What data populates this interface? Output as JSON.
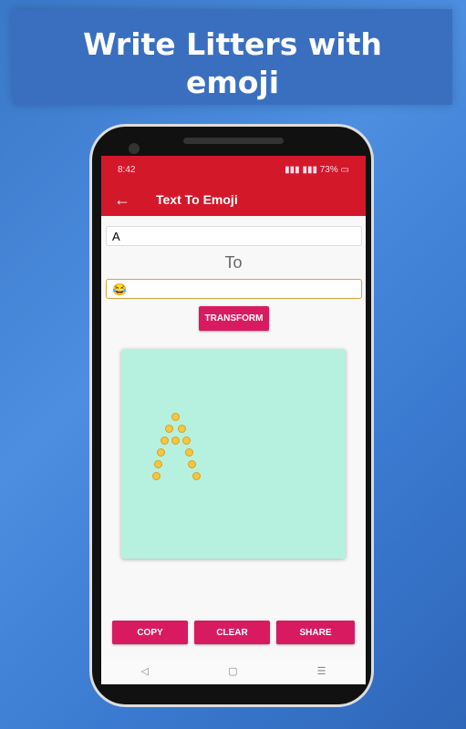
{
  "banner": {
    "line1": "Write Litters with",
    "line2": "emoji"
  },
  "status": {
    "time": "8:42",
    "battery": "73%",
    "icons": "vibrate-icon signal-icon signal-icon battery-icon"
  },
  "appbar": {
    "back_icon": "←",
    "title": "Text To Emoji"
  },
  "form": {
    "text_value": "A",
    "to_label": "To",
    "emoji_value": "😂",
    "transform_label": "TRANSFORM"
  },
  "actions": {
    "copy": "COPY",
    "clear": "CLEAR",
    "share": "SHARE"
  },
  "nav": {
    "back": "◁",
    "home": "▢",
    "recents": "☰"
  },
  "colors": {
    "primary": "#d3182a",
    "accent": "#d81b60",
    "canvas": "#b6f1df"
  }
}
